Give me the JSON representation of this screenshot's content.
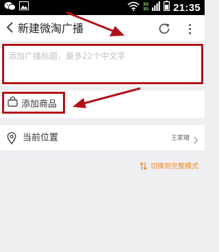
{
  "status_bar": {
    "net_top": "3G",
    "net_bottom": "3G",
    "time": "21:35"
  },
  "header": {
    "title": "新建微淘广播"
  },
  "form": {
    "title_placeholder": "添加广播标题，最多22个中文字",
    "title_value": ""
  },
  "product": {
    "add_label": "添加商品"
  },
  "location": {
    "label": "当前位置",
    "value": "王家塘"
  },
  "mode_switch": {
    "label": "切换到完整模式"
  },
  "colors": {
    "accent_orange": "#f08a24",
    "annotation_red": "#b11118",
    "status_bar": "#000000"
  },
  "icons": {
    "wechat": "wechat-icon",
    "image": "image-notification-icon",
    "wifi": "wifi-icon",
    "signal": "signal-icon",
    "battery": "battery-icon",
    "back": "chevron-left-icon",
    "refresh": "refresh-icon",
    "more": "more-vertical-icon",
    "bag": "shopping-bag-icon",
    "location": "location-pin-icon",
    "chevron": "chevron-right-icon",
    "switch": "switch-arrows-icon"
  }
}
